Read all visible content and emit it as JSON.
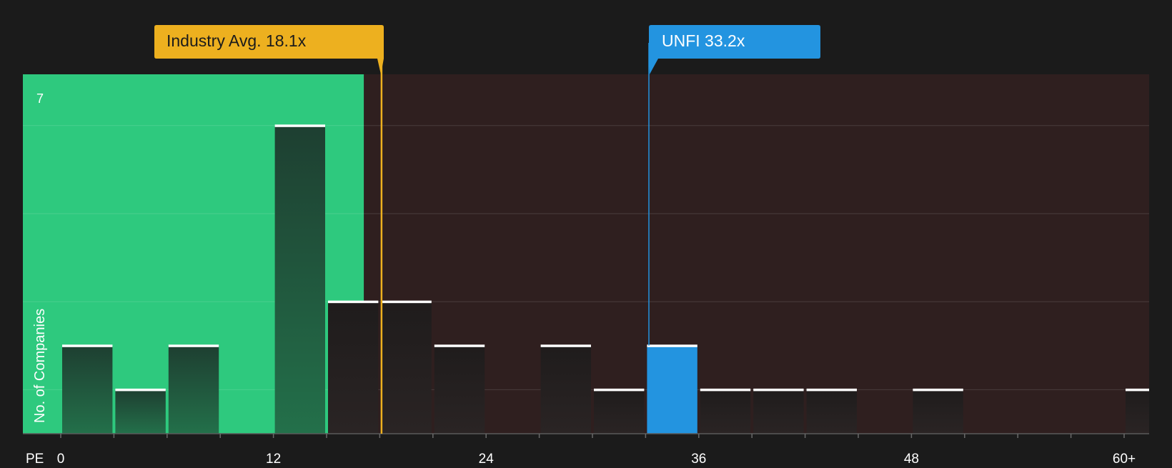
{
  "chart_data": {
    "type": "bar",
    "x_axis_label": "PE",
    "y_axis_label": "No. of Companies",
    "y_tick_labels": [
      "7"
    ],
    "x_tick_labels": [
      "0",
      "12",
      "24",
      "36",
      "48",
      "60+"
    ],
    "x_tick_values": [
      0,
      12,
      24,
      36,
      48,
      60
    ],
    "xlim": [
      -2.2,
      62
    ],
    "ylim": [
      0,
      7.3
    ],
    "bin_width": 3,
    "bins": [
      {
        "start": 0,
        "count": 2
      },
      {
        "start": 3,
        "count": 1
      },
      {
        "start": 6,
        "count": 2
      },
      {
        "start": 9,
        "count": 0
      },
      {
        "start": 12,
        "count": 7
      },
      {
        "start": 15,
        "count": 3
      },
      {
        "start": 18,
        "count": 3
      },
      {
        "start": 21,
        "count": 2
      },
      {
        "start": 24,
        "count": 0
      },
      {
        "start": 27,
        "count": 2
      },
      {
        "start": 30,
        "count": 1
      },
      {
        "start": 33,
        "count": 2,
        "highlight": true
      },
      {
        "start": 36,
        "count": 1
      },
      {
        "start": 39,
        "count": 1
      },
      {
        "start": 42,
        "count": 1
      },
      {
        "start": 45,
        "count": 0
      },
      {
        "start": 48,
        "count": 1
      },
      {
        "start": 51,
        "count": 0
      },
      {
        "start": 54,
        "count": 0
      },
      {
        "start": 57,
        "count": 0
      },
      {
        "start": 60,
        "count": 1
      }
    ],
    "industry_avg": {
      "label": "Industry Avg. 18.1x",
      "value": 18.1
    },
    "company": {
      "label": "UNFI 33.2x",
      "value": 33.2
    },
    "grid": true
  },
  "colors": {
    "background": "#1b1b1b",
    "below_avg_zone": "#2ec97e",
    "above_avg_zone": "#2f1f1f",
    "bar_dark": "#1f4a36",
    "bar_neutral": "#252222",
    "bar_highlight": "#2394e0",
    "industry_flag": "#edb01f",
    "company_flag": "#2394e0"
  }
}
